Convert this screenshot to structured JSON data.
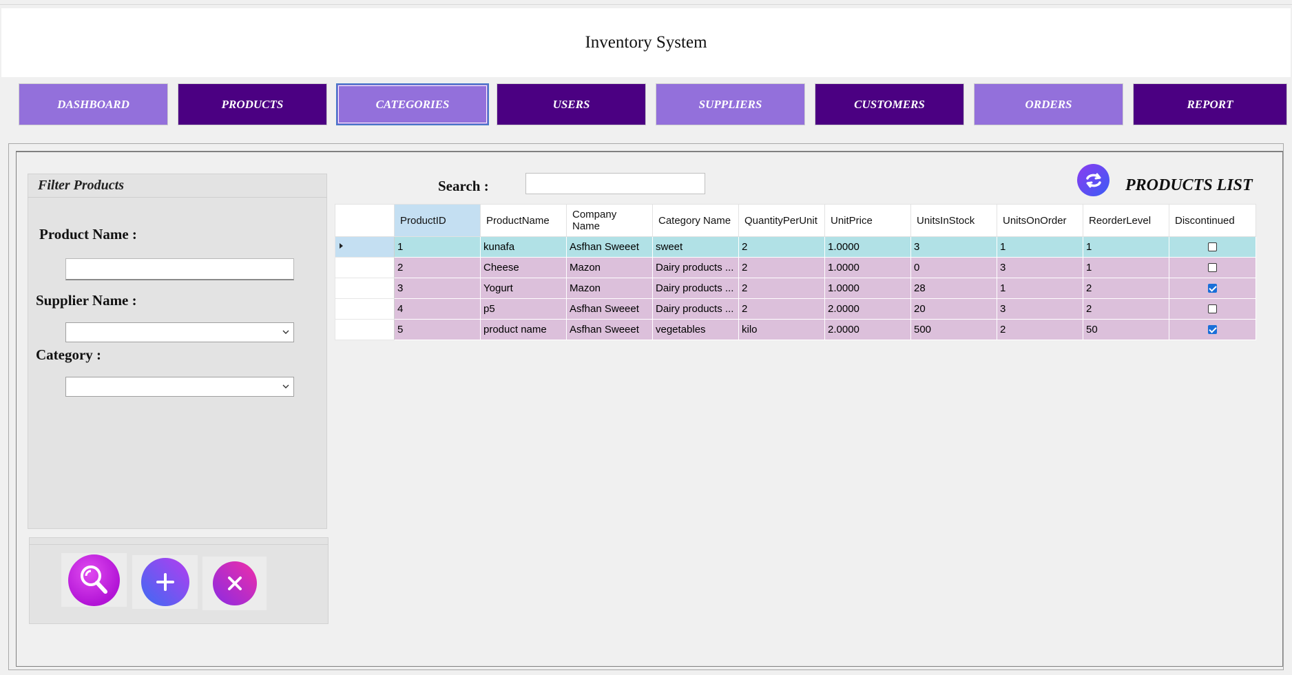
{
  "app": {
    "title": "Inventory System"
  },
  "nav": [
    {
      "label": "DASHBOARD",
      "style": "light"
    },
    {
      "label": "PRODUCTS",
      "style": "dark"
    },
    {
      "label": "CATEGORIES",
      "style": "active"
    },
    {
      "label": "USERS",
      "style": "dark"
    },
    {
      "label": "SUPPLIERS",
      "style": "light"
    },
    {
      "label": "CUSTOMERS",
      "style": "dark"
    },
    {
      "label": "ORDERS",
      "style": "light"
    },
    {
      "label": "REPORT",
      "style": "dark"
    }
  ],
  "filter": {
    "title": "Filter Products",
    "product_name_label": "Product Name :",
    "product_name_value": "",
    "supplier_label": "Supplier Name :",
    "supplier_value": "",
    "category_label": "Category :",
    "category_value": ""
  },
  "actions": {
    "search_icon": "search-icon",
    "add_icon": "plus-icon",
    "clear_icon": "close-icon"
  },
  "list": {
    "search_label": "Search :",
    "search_value": "",
    "title": "PRODUCTS LIST",
    "refresh_icon": "refresh-icon"
  },
  "table": {
    "columns": [
      "ProductID",
      "ProductName",
      "Company Name",
      "Category Name",
      "QuantityPerUnit",
      "UnitPrice",
      "UnitsInStock",
      "UnitsOnOrder",
      "ReorderLevel",
      "Discontinued"
    ],
    "rows": [
      {
        "cells": [
          "1",
          "kunafa",
          "Asfhan Sweeet",
          "sweet",
          "2",
          "1.0000",
          "3",
          "1",
          "1"
        ],
        "discontinued": false,
        "selected": true
      },
      {
        "cells": [
          "2",
          "Cheese",
          "Mazon",
          "Dairy products ...",
          "2",
          "1.0000",
          "0",
          "3",
          "1"
        ],
        "discontinued": false,
        "selected": false
      },
      {
        "cells": [
          "3",
          "Yogurt",
          "Mazon",
          "Dairy products ...",
          "2",
          "1.0000",
          "28",
          "1",
          "2"
        ],
        "discontinued": true,
        "selected": false
      },
      {
        "cells": [
          "4",
          "p5",
          "Asfhan Sweeet",
          "Dairy products ...",
          "2",
          "2.0000",
          "20",
          "3",
          "2"
        ],
        "discontinued": false,
        "selected": false
      },
      {
        "cells": [
          "5",
          "product name",
          "Asfhan Sweeet",
          "vegetables",
          "kilo",
          "2.0000",
          "500",
          "2",
          "50"
        ],
        "discontinued": true,
        "selected": false
      }
    ]
  },
  "colors": {
    "nav_light": "#9370db",
    "nav_dark": "#4b0082",
    "row_selected": "#b1e1e6",
    "row_normal": "#dcc0db"
  }
}
